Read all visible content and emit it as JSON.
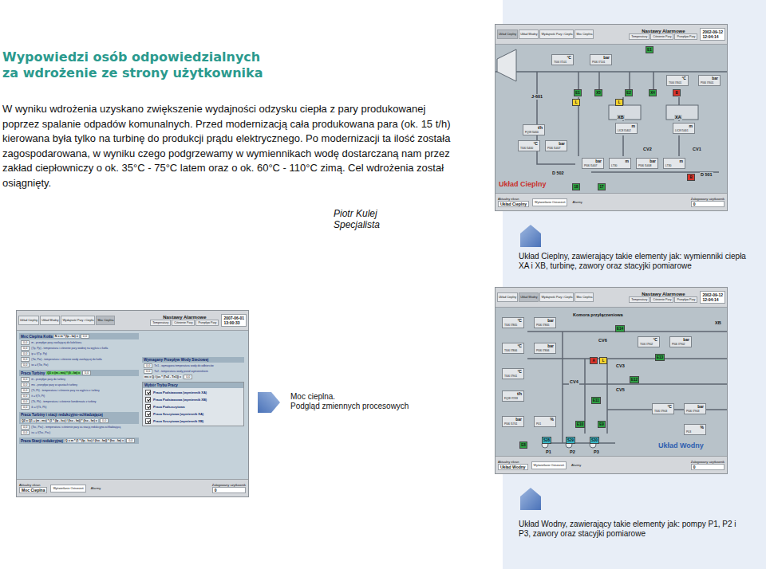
{
  "article": {
    "title": [
      "Wypowiedzi osób odpowiedzialnych",
      "za wdrożenie ze strony użytkownika"
    ],
    "paragraph": "W wyniku wdrożenia uzyskano zwiększenie wydajności odzysku ciepła z pary produkowanej poprzez spalanie odpadów komunalnych. Przed modernizacją cała produkowana para (ok. 15 t/h) kierowana była tylko na turbinę do produkcji prądu elektrycznego. Po modernizacji ta ilość została zagospodarowana, w wyniku czego podgrzewamy w wymiennikach wodę dostarczaną nam przez zakład ciepłowniczy o ok. 35°C - 75°C latem oraz o ok. 60°C - 110°C zimą. Cel wdrożenia został osiągnięty.",
    "author": [
      "Piotr Kulej",
      "Specjalista"
    ]
  },
  "heat": {
    "caption": "Układ Cieplny, zawierający takie elementy jak: wymienniki ciepła XA i XB, turbinę, zawory oraz stacyjki pomiarowe",
    "screen": {
      "tabs": [
        {
          "label": "Układ Cieplny",
          "selected": true
        },
        {
          "label": "Układ Wodny",
          "selected": false
        },
        {
          "label": "Wydajność Pary i Ciepła",
          "selected": false
        },
        {
          "label": "Moc Cieplna",
          "selected": false
        }
      ],
      "alarms": {
        "title": "Nastawy Alarmowe",
        "tabs": [
          "Temperatury",
          "Ciśnienie Pary",
          "Przepływ Pary"
        ]
      },
      "date": "2002-09-12",
      "time": "12:04:14",
      "status": {
        "label": "Aktualny ekran",
        "name": "Układ Cieplny",
        "middle": "Wyświetlanie Ostrzeżeń",
        "alarm": "Alarmy",
        "user_label": "Zalogowany użytkownik",
        "user": "0"
      }
    },
    "title": "Układ Cieplny",
    "units": [
      {
        "unit": "°C",
        "tag": "TI06 I7101"
      },
      {
        "unit": "bar",
        "tag": "PI06 I7101"
      },
      {
        "unit": "°C",
        "tag": "TI06 I7601"
      },
      {
        "unit": "bar",
        "tag": "PI06 I7601"
      },
      {
        "unit": "t/h",
        "tag": "FQI8 I5400"
      },
      {
        "unit": "°C",
        "tag": "TI06 I5400"
      },
      {
        "unit": "bar",
        "tag": "PI06 I5407"
      },
      {
        "unit": "m",
        "tag": "LIC8 I5402"
      },
      {
        "unit": "m",
        "tag": "LIC8 I5401"
      },
      {
        "unit": "bar",
        "tag": "PI06 I5407"
      },
      {
        "unit": "m",
        "tag": "LT30"
      },
      {
        "unit": "bar",
        "tag": "PI06 I5408"
      },
      {
        "unit": "m",
        "tag": "LT30"
      }
    ],
    "devices": [
      "J-601",
      "XB",
      "XA",
      "CV2",
      "CV1",
      "D 502",
      "D 501"
    ],
    "badges": [
      {
        "text": "E1",
        "color": "#2ea043"
      },
      {
        "text": "E1",
        "color": "#2ea043"
      },
      {
        "text": "X5",
        "color": "#2ea043"
      },
      {
        "text": "E2",
        "color": "#2ea043"
      },
      {
        "text": "X4",
        "color": "#2ea043"
      },
      {
        "text": "B",
        "color": "#d9342b"
      },
      {
        "text": "L",
        "color": "#f2d22e"
      },
      {
        "text": "L",
        "color": "#f2d22e"
      },
      {
        "text": "B",
        "color": "#d9342b"
      },
      {
        "text": "18",
        "color": "#2ea043"
      },
      {
        "text": "17",
        "color": "#2ea043"
      }
    ]
  },
  "power": {
    "caption": [
      "Moc cieplna.",
      "Podgląd zmiennych procesowych"
    ],
    "screen": {
      "tabs": [
        {
          "label": "Układ Cieplny",
          "selected": false
        },
        {
          "label": "Układ Wodny",
          "selected": false
        },
        {
          "label": "Wydajność Pary i Ciepła",
          "selected": false
        },
        {
          "label": "Moc Cieplna",
          "selected": true
        }
      ],
      "alarms": {
        "title": "Nastawy Alarmowe",
        "tabs": [
          "Temperatury",
          "Ciśnienie Pary",
          "Przepływ Pary"
        ]
      },
      "date": "2007-06-01",
      "time": "13:00:33",
      "status": {
        "label": "Aktualny ekran",
        "name": "Moc Cieplna",
        "middle": "Wyświetlanie Ostrzeżeń",
        "alarm": "Alarmy",
        "user_label": "Zalogowany użytkownik",
        "user": "0"
      }
    },
    "left": [
      {
        "title": "Moc Cieplna Kotła",
        "formula": "N = m * (Ip - Iw) =",
        "value": "0,0",
        "green": false,
        "rows": [
          {
            "value": "0,0",
            "desc": "m - przepływ pary zasilającej do kolektora"
          },
          {
            "value": "0,0",
            "desc": "(Tp, Pp) - temperatura i ciśnienie pary wodnej na wyjściu z kotła"
          },
          {
            "value": "0,0",
            "desc": "ip = f(Tp, Pp)"
          },
          {
            "value": "0,0",
            "desc": "(Tw, Pw) - temperatura i ciśnienie wody zasilającej do kotła"
          },
          {
            "value": "0,0",
            "desc": "iw = f(Tw, Pw)"
          }
        ]
      },
      {
        "title": "Praca Turbiny",
        "formula": "Q1 = (m - ms) * (Ii - Iw) =",
        "value": "0,0",
        "green": true,
        "rows": [
          {
            "value": "0,0",
            "desc": "m - przepływ pary do turbiny"
          },
          {
            "value": "0,0",
            "desc": "ms - przepływ pary w upustach turbiny"
          },
          {
            "value": "0,0",
            "desc": "(Tt, Pt) - temperatura i ciśnienie pary na wyjściu z turbiny"
          },
          {
            "value": "0,0",
            "desc": "it = f(Tt, Pt)"
          },
          {
            "value": "0,0",
            "desc": "(Tk, Pk) - temperatura i ciśnienie kondensatu z turbiny"
          },
          {
            "value": "0,0",
            "desc": "ik = f(Tk, Pk)"
          }
        ]
      },
      {
        "title": "Praca Turbiny i stacji redukcyjno-schładzającej",
        "formula": "Q2 = Q1 + (m - ms) * (1 * (Ip - Isc) / (Isc - Iw)) * (Isc - Iw) =",
        "value": "0,0",
        "green": false,
        "rows": [
          {
            "value": "0,0",
            "desc": "(Tsc, Psc) - temperatura i ciśnienie pary za stacją redukcyjno-schładzającą"
          },
          {
            "value": "0,0",
            "desc": "isc = f(Tsc, Psc)"
          }
        ]
      },
      {
        "title": "Praca Stacji redukcyjnej",
        "formula": "Q = m * (1 * (Ip - Isc) / (Isc - Iw)) * (Isc - Iw) =",
        "value": "0,0",
        "green": false,
        "rows": []
      }
    ],
    "flow": {
      "title": "Wymagany Przepływ Wody Sieciowej",
      "rows": [
        {
          "value": "0,0",
          "desc": "Tn1 - wymagana temperatura wody do odbiorców"
        },
        {
          "value": "0,0",
          "desc": "Tx2 - temperatura wody przed wymiennikiem"
        }
      ],
      "formula": "ms = Q / (cs * (Tx2 - Tn1)) =",
      "value": "0,0"
    },
    "modes": {
      "title": "Wybór Trybu Pracy",
      "items": [
        {
          "label": "Praca Podstawowa (wymiennik XA)",
          "checked": true
        },
        {
          "label": "Praca Podstawowa (wymiennik XB)",
          "checked": true
        },
        {
          "label": "Praca Podszczytowa",
          "checked": true
        },
        {
          "label": "Praca Szczytowa (wymiennik XA)",
          "checked": true
        },
        {
          "label": "Praca Szczytowa (wymiennik XB)",
          "checked": true
        }
      ]
    }
  },
  "water": {
    "caption": "Układ Wodny, zawierający takie elementy jak: pompy P1, P2 i P3, zawory oraz stacyjki pomiarowe",
    "screen": {
      "tabs": [
        {
          "label": "Układ Cieplny",
          "selected": false
        },
        {
          "label": "Układ Wodny",
          "selected": true
        },
        {
          "label": "Wydajność Pary i Ciepła",
          "selected": false
        },
        {
          "label": "Moc Cieplna",
          "selected": false
        }
      ],
      "alarms": {
        "title": "Nastawy Alarmowe",
        "tabs": [
          "Temperatury",
          "Ciśnienie Pary",
          "Przepływ Pary"
        ]
      },
      "date": "2002-09-12",
      "time": "12:04:14",
      "status": {
        "label": "Aktualny ekran",
        "name": "Układ Wodny",
        "middle": "Wyświetlanie Ostrzeżeń",
        "alarm": "Alarmy",
        "user_label": "Zalogowany użytkownik",
        "user": "0"
      }
    },
    "title": "Układ Wodny",
    "units": [
      {
        "unit": "°C",
        "tag": "TI06 I7805"
      },
      {
        "unit": "bar",
        "tag": "PI06 I7805"
      },
      {
        "unit": "°C",
        "tag": "TI06 I7806"
      },
      {
        "unit": "bar",
        "tag": "PI06 I7806"
      },
      {
        "unit": "°C",
        "tag": "TI06 I7901"
      },
      {
        "unit": "t/h",
        "tag": "FQI8 I7233"
      },
      {
        "unit": "bar",
        "tag": "PI06 I5701"
      },
      {
        "unit": "%",
        "tag": "P01"
      },
      {
        "unit": "°C",
        "tag": "TI06 I7902"
      },
      {
        "unit": "bar",
        "tag": "PI06 I7902"
      },
      {
        "unit": "°C",
        "tag": "TI06 I7903"
      },
      {
        "unit": "bar",
        "tag": "PI06 I7903"
      },
      {
        "unit": "%",
        "tag": "P03"
      }
    ],
    "devices": [
      "Komora przyłączeniowa",
      "CV6",
      "CV3",
      "CV4",
      "CV5",
      "XB",
      "P1",
      "P2",
      "P3"
    ],
    "badges": [
      {
        "text": "E14",
        "color": "#2ea043"
      },
      {
        "text": "E13",
        "color": "#2ea043"
      },
      {
        "text": "A",
        "color": "#d9342b"
      },
      {
        "text": "L",
        "color": "#f2d22e"
      },
      {
        "text": "E12",
        "color": "#2ea043"
      },
      {
        "text": "E11",
        "color": "#2ea043"
      },
      {
        "text": "E10",
        "color": "#2ea043"
      },
      {
        "text": "E9",
        "color": "#2ea043"
      },
      {
        "text": "S28",
        "color": "#39b8c8"
      },
      {
        "text": "S29",
        "color": "#39b8c8"
      },
      {
        "text": "S30",
        "color": "#39b8c8"
      },
      {
        "text": "E8",
        "color": "#2ea043"
      }
    ]
  }
}
